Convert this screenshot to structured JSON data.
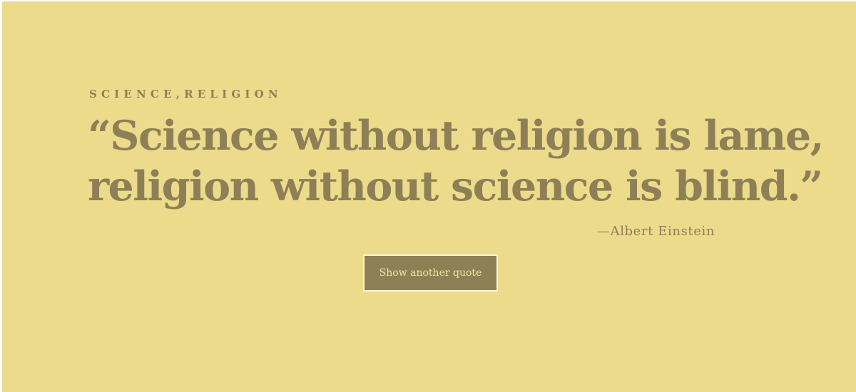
{
  "quote": {
    "tags": "SCIENCE,RELIGION",
    "line1": "“Science without religion is lame,",
    "line2": "religion without science is blind.”",
    "author": "—Albert Einstein"
  },
  "actions": {
    "show_another_label": "Show another quote"
  },
  "colors": {
    "background": "#ecdb8b",
    "text": "#8d8057",
    "button_bg": "#8d8057",
    "button_text": "#f3e69c",
    "button_border": "#fff8dc"
  }
}
